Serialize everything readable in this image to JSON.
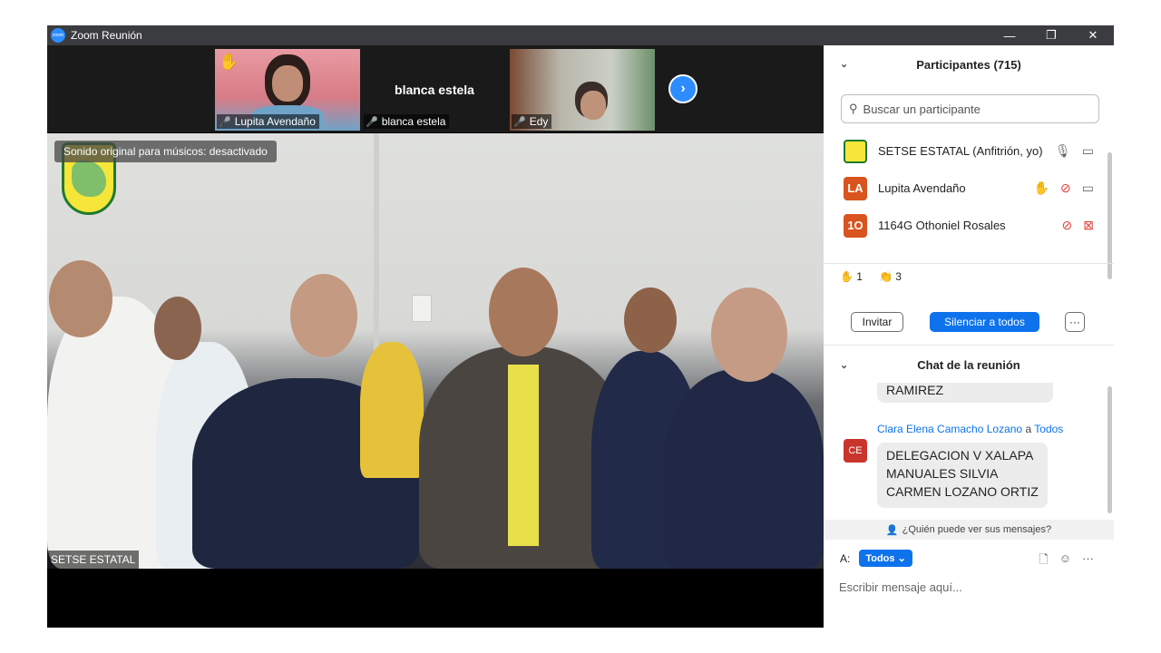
{
  "window": {
    "title": "Zoom Reunión",
    "logo_text": "zoom",
    "minimize": "—",
    "restore": "❐",
    "close": "✕"
  },
  "strip": {
    "participants": [
      {
        "name": "Lupita Avendaño",
        "hand": "✋"
      },
      {
        "name": "blanca estela",
        "display": "blanca estela"
      },
      {
        "name": "Edy"
      }
    ],
    "next": "›"
  },
  "main": {
    "audio_notice": "Sonido original para músicos: desactivado",
    "speaker": "SETSE ESTATAL"
  },
  "panel": {
    "participants_title": "Participantes (715)",
    "search_placeholder": "Buscar un participante",
    "list": [
      {
        "avatar": "",
        "avatar_color": "#f6e63a",
        "name": "SETSE ESTATAL (Anfitrión, yo)"
      },
      {
        "avatar": "LA",
        "avatar_color": "#d9541e",
        "name": "Lupita Avendaño"
      },
      {
        "avatar": "1O",
        "avatar_color": "#d9541e",
        "name": "1164G Othoniel Rosales"
      }
    ],
    "reactions": {
      "hand_count": "1",
      "clap_count": "3"
    },
    "invite": "Invitar",
    "mute_all": "Silenciar a todos",
    "more": "···",
    "chat_title": "Chat de la reunión",
    "chat": {
      "prev_tail": "RAMIREZ",
      "sender": "Clara Elena Camacho Lozano",
      "to_word": "a",
      "recipient": "Todos",
      "avatar": "CE",
      "lines": [
        "DELEGACION V XALAPA",
        "MANUALES SILVIA",
        "CARMEN LOZANO ORTIZ"
      ]
    },
    "who_can_see": "¿Quién puede ver sus mensajes?",
    "to_label": "A:",
    "to_value": "Todos",
    "compose_placeholder": "Escribir mensaje aquí..."
  }
}
